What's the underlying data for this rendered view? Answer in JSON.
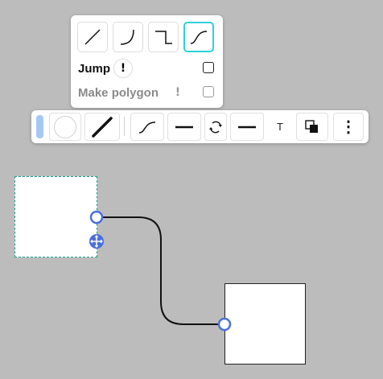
{
  "route_panel": {
    "routes": [
      {
        "name": "straight",
        "icon": "straight-line-icon",
        "active": false
      },
      {
        "name": "curved-corner",
        "icon": "curve-corner-icon",
        "active": false
      },
      {
        "name": "orthogonal",
        "icon": "orthogonal-line-icon",
        "active": false
      },
      {
        "name": "smooth",
        "icon": "smooth-curve-icon",
        "active": true
      }
    ],
    "jump_label": "Jump",
    "polygon_label": "Make polygon",
    "info_glyph": "!",
    "jump_checked": false,
    "polygon_checked": false
  },
  "toolbar": {
    "fill_color": "#a6c8f5",
    "text_glyph": "T",
    "more_glyph": "⋮"
  },
  "colors": {
    "background": "#bcbcbc",
    "accent": "#2fd0dc",
    "handle": "#4a6fdc",
    "selection_border": "#1a9a8a"
  }
}
